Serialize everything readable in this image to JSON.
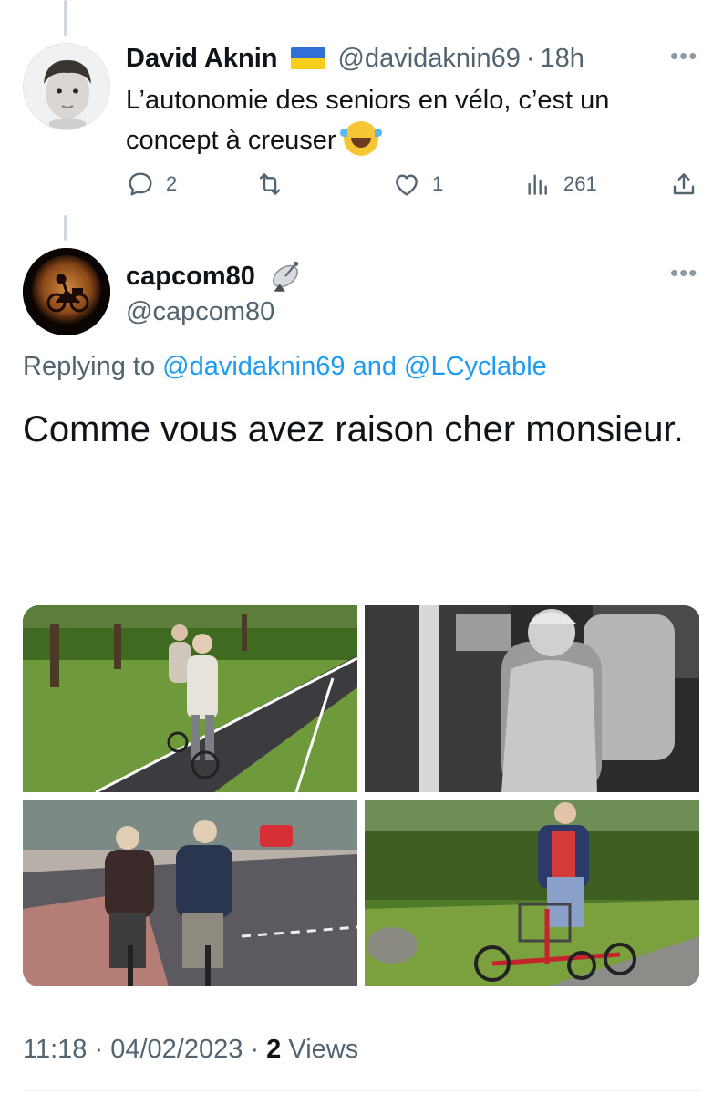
{
  "parent_tweet": {
    "display_name": "David Aknin",
    "flag": "ukraine-flag",
    "handle": "@davidaknin69",
    "separator": "·",
    "time": "18h",
    "text": "L’autonomie des seniors en vélo, c’est un concept à creuser",
    "emoji": "face-with-tears-of-joy",
    "stats": {
      "replies": "2",
      "retweets": "",
      "likes": "1",
      "views": "261"
    }
  },
  "reply_tweet": {
    "display_name": "capcom80",
    "badge_icon": "satellite-antenna-icon",
    "handle": "@capcom80",
    "replying_prefix": "Replying to",
    "replying_user1": "@davidaknin69",
    "replying_and": "and",
    "replying_user2": "@LCyclable",
    "text": "Comme vous avez raison cher monsieur.",
    "media_count": 4,
    "meta": {
      "time": "11:18",
      "sep1": "·",
      "date": "04/02/2023",
      "sep2": "·",
      "views_count": "2",
      "views_label": "Views"
    }
  },
  "colors": {
    "text": "#0f1419",
    "secondary": "#536471",
    "link": "#1d9bf0",
    "thread_line": "#cfd9de"
  },
  "icons": [
    "more-icon",
    "reply-icon",
    "retweet-icon",
    "like-icon",
    "views-icon",
    "share-icon"
  ]
}
